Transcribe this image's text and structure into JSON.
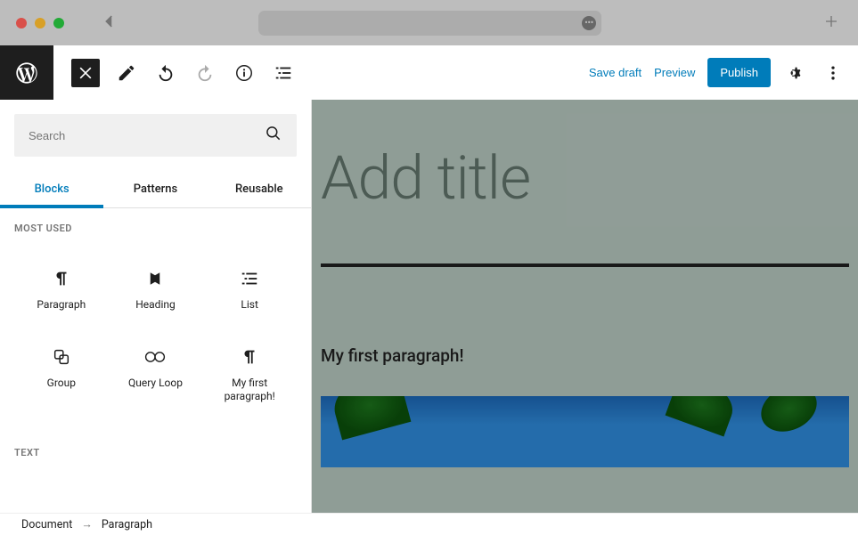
{
  "chrome": {
    "address_dots": "•••"
  },
  "toolbar": {
    "save_draft": "Save draft",
    "preview": "Preview",
    "publish": "Publish"
  },
  "inserter": {
    "search_placeholder": "Search",
    "tabs": {
      "blocks": "Blocks",
      "patterns": "Patterns",
      "reusable": "Reusable"
    },
    "sections": {
      "most_used": "MOST USED",
      "text": "TEXT"
    },
    "blocks": {
      "paragraph": "Paragraph",
      "heading": "Heading",
      "list": "List",
      "group": "Group",
      "query_loop": "Query Loop",
      "my_first": "My first paragraph!"
    }
  },
  "canvas": {
    "title_placeholder": "Add title",
    "paragraph_text": "My first paragraph!"
  },
  "breadcrumb": {
    "document": "Document",
    "paragraph": "Paragraph"
  },
  "colors": {
    "accent": "#007cba",
    "canvas_bg": "#a9b9b1"
  }
}
